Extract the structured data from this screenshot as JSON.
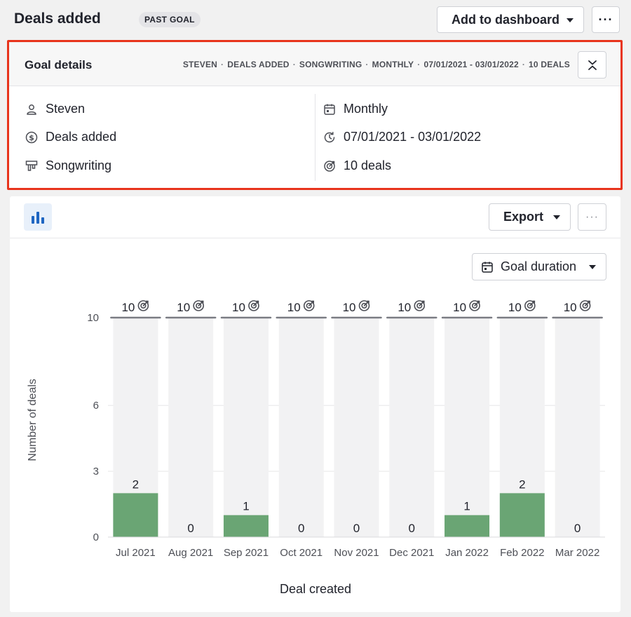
{
  "header": {
    "title": "Deals added",
    "badge": "PAST GOAL",
    "add_button": "Add to dashboard",
    "more": "···"
  },
  "goal": {
    "title": "Goal details",
    "summary": [
      "STEVEN",
      "DEALS ADDED",
      "SONGWRITING",
      "MONTHLY",
      "07/01/2021 - 03/01/2022",
      "10 DEALS"
    ],
    "assignee": "Steven",
    "goal_type": "Deals added",
    "pipeline": "Songwriting",
    "interval": "Monthly",
    "period": "07/01/2021 - 03/01/2022",
    "target": "10 deals",
    "icons": {
      "assignee": "user-icon",
      "goal_type": "dollar-circle-icon",
      "pipeline": "pipeline-icon",
      "interval": "calendar-icon",
      "period": "clock-history-icon",
      "target": "target-icon",
      "close": "collapse-icon"
    }
  },
  "chart_toolbar": {
    "export": "Export",
    "more": "···",
    "duration": "Goal duration"
  },
  "chart_data": {
    "type": "bar",
    "categories": [
      "Jul 2021",
      "Aug 2021",
      "Sep 2021",
      "Oct 2021",
      "Nov 2021",
      "Dec 2021",
      "Jan 2022",
      "Feb 2022",
      "Mar 2022"
    ],
    "values": [
      2,
      0,
      1,
      0,
      0,
      0,
      1,
      2,
      0
    ],
    "goal_values": [
      10,
      10,
      10,
      10,
      10,
      10,
      10,
      10,
      10
    ],
    "ylabel": "Number of deals",
    "xlabel": "Deal created",
    "yticks": [
      0,
      3,
      6,
      10
    ],
    "ylim": [
      0,
      10
    ],
    "grid": true,
    "colors": {
      "bar": "#6aa574",
      "goal_bg": "#f2f2f3",
      "goal_line": "#7a7c83"
    }
  }
}
